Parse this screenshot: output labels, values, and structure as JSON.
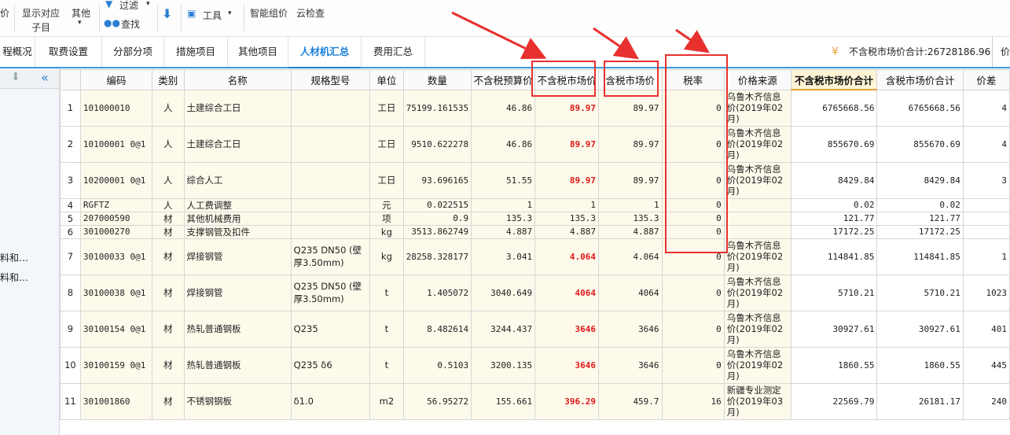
{
  "toolbar": {
    "left_glyph": "价",
    "show_item_l1": "显示对应",
    "show_item_l2": "子目",
    "other_label": "其他",
    "filter_label": "过滤",
    "find_label": "查找",
    "tools_label": "工具",
    "smart_price_label": "智能组价",
    "cloud_check_label": "云检查"
  },
  "tabs": [
    "程概况",
    "取费设置",
    "分部分项",
    "措施项目",
    "其他项目",
    "人材机汇总",
    "费用汇总"
  ],
  "active_tab": "人材机汇总",
  "summary": {
    "text": "不含税市场价合计:26728186.96",
    "cut": "价"
  },
  "left_items": [
    "料和…",
    "料和…"
  ],
  "columns": [
    "编码",
    "类别",
    "名称",
    "规格型号",
    "单位",
    "数量",
    "不含税预算价",
    "不含税市场价",
    "含税市场价",
    "税率",
    "价格来源",
    "不含税市场价合计",
    "含税市场价合计",
    "价差"
  ],
  "rows": [
    {
      "no": "1",
      "code": "101000010",
      "cat": "人",
      "name": "土建综合工日",
      "spec": "",
      "unit": "工日",
      "qty": "75199.161535",
      "budget": "46.86",
      "market": "89.97",
      "tax_market": "89.97",
      "rate": "0",
      "source": "乌鲁木齐信息价(2019年02月)",
      "total": "6765668.56",
      "tax_total": "6765668.56",
      "diff": "4"
    },
    {
      "no": "2",
      "code": "10100001 0@1",
      "cat": "人",
      "name": "土建综合工日",
      "spec": "",
      "unit": "工日",
      "qty": "9510.622278",
      "budget": "46.86",
      "market": "89.97",
      "tax_market": "89.97",
      "rate": "0",
      "source": "乌鲁木齐信息价(2019年02月)",
      "total": "855670.69",
      "tax_total": "855670.69",
      "diff": "4"
    },
    {
      "no": "3",
      "code": "10200001 0@1",
      "cat": "人",
      "name": "综合人工",
      "spec": "",
      "unit": "工日",
      "qty": "93.696165",
      "budget": "51.55",
      "market": "89.97",
      "tax_market": "89.97",
      "rate": "0",
      "source": "乌鲁木齐信息价(2019年02月)",
      "total": "8429.84",
      "tax_total": "8429.84",
      "diff": "3"
    },
    {
      "no": "4",
      "code": "RGFTZ",
      "cat": "人",
      "name": "人工费调整",
      "spec": "",
      "unit": "元",
      "qty": "0.022515",
      "budget": "1",
      "market": "1",
      "tax_market": "1",
      "rate": "0",
      "source": "",
      "total": "0.02",
      "tax_total": "0.02",
      "diff": ""
    },
    {
      "no": "5",
      "code": "207000590",
      "cat": "材",
      "name": "其他机械费用",
      "spec": "",
      "unit": "项",
      "qty": "0.9",
      "budget": "135.3",
      "market": "135.3",
      "tax_market": "135.3",
      "rate": "0",
      "source": "",
      "total": "121.77",
      "tax_total": "121.77",
      "diff": ""
    },
    {
      "no": "6",
      "code": "301000270",
      "cat": "材",
      "name": "支撑钢管及扣件",
      "spec": "",
      "unit": "kg",
      "qty": "3513.862749",
      "budget": "4.887",
      "market": "4.887",
      "tax_market": "4.887",
      "rate": "0",
      "source": "",
      "total": "17172.25",
      "tax_total": "17172.25",
      "diff": ""
    },
    {
      "no": "7",
      "code": "30100033 0@1",
      "cat": "材",
      "name": "焊接钢管",
      "spec": "Q235 DN50 (壁厚3.50mm)",
      "unit": "kg",
      "qty": "28258.328177",
      "budget": "3.041",
      "market": "4.064",
      "tax_market": "4.064",
      "rate": "0",
      "source": "乌鲁木齐信息价(2019年02月)",
      "total": "114841.85",
      "tax_total": "114841.85",
      "diff": "1"
    },
    {
      "no": "8",
      "code": "30100038 0@1",
      "cat": "材",
      "name": "焊接钢管",
      "spec": "Q235 DN50 (壁厚3.50mm)",
      "unit": "t",
      "qty": "1.405072",
      "budget": "3040.649",
      "market": "4064",
      "tax_market": "4064",
      "rate": "0",
      "source": "乌鲁木齐信息价(2019年02月)",
      "total": "5710.21",
      "tax_total": "5710.21",
      "diff": "1023"
    },
    {
      "no": "9",
      "code": "30100154 0@1",
      "cat": "材",
      "name": "热轧普通钢板",
      "spec": "Q235",
      "unit": "t",
      "qty": "8.482614",
      "budget": "3244.437",
      "market": "3646",
      "tax_market": "3646",
      "rate": "0",
      "source": "乌鲁木齐信息价(2019年02月)",
      "total": "30927.61",
      "tax_total": "30927.61",
      "diff": "401"
    },
    {
      "no": "10",
      "code": "30100159 0@1",
      "cat": "材",
      "name": "热轧普通钢板",
      "spec": "Q235 δ6",
      "unit": "t",
      "qty": "0.5103",
      "budget": "3200.135",
      "market": "3646",
      "tax_market": "3646",
      "rate": "0",
      "source": "乌鲁木齐信息价(2019年02月)",
      "total": "1860.55",
      "tax_total": "1860.55",
      "diff": "445"
    },
    {
      "no": "11",
      "code": "301001860",
      "cat": "材",
      "name": "不锈钢钢板",
      "spec": "δ1.0",
      "unit": "m2",
      "qty": "56.95272",
      "budget": "155.661",
      "market": "396.29",
      "tax_market": "459.7",
      "rate": "16",
      "source": "新疆专业测定价(2019年03月)",
      "total": "22569.79",
      "tax_total": "26181.17",
      "diff": "240"
    }
  ]
}
